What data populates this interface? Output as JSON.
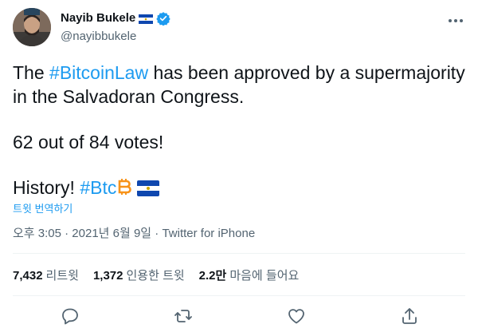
{
  "author": {
    "name": "Nayib Bukele",
    "handle": "@nayibbukele",
    "avatar_icon": "profile-photo",
    "flag_icon": "el-salvador-flag",
    "verified_icon": "verified-badge-icon"
  },
  "tweet": {
    "line1_pre": "The ",
    "line1_tag": "#BitcoinLaw",
    "line1_post": " has been approved by a supermajority",
    "line2": "in the Salvadoran Congress.",
    "line3": "62 out of 84 votes!",
    "line4_pre": "History! ",
    "line4_tag": "#Btc",
    "translate_label": "트윗 번역하기"
  },
  "meta": {
    "timestamp": "오후 3:05 · 2021년 6월 9일",
    "separator": " · ",
    "client": "Twitter for iPhone"
  },
  "stats": {
    "retweets_count": "7,432",
    "retweets_label": "리트윗",
    "quotes_count": "1,372",
    "quotes_label": "인용한 트윗",
    "likes_count": "2.2만",
    "likes_label": "마음에 들어요"
  },
  "actions": [
    "reply-icon",
    "retweet-icon",
    "like-icon",
    "share-icon"
  ],
  "colors": {
    "accent": "#1d9bf0",
    "secondary_text": "#536471",
    "divider": "#eff3f4",
    "bitcoin": "#f7931a",
    "flag_blue": "#0f47af"
  }
}
